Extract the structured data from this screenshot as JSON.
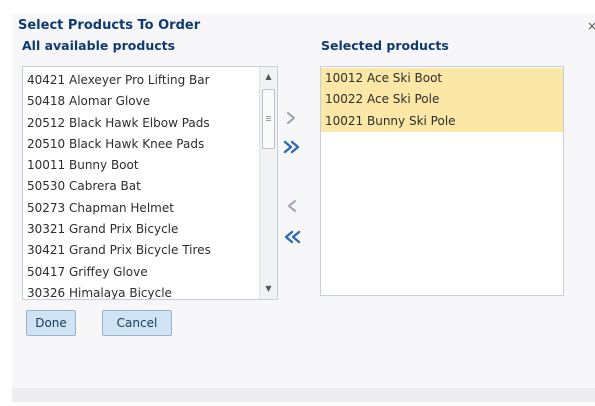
{
  "dialog": {
    "title": "Select Products To Order",
    "close_glyph": "×"
  },
  "available": {
    "heading": "All available products",
    "items": [
      "40421 Alexeyer Pro Lifting Bar",
      "50418 Alomar Glove",
      "20512 Black Hawk Elbow Pads",
      "20510 Black Hawk Knee Pads",
      "10011 Bunny Boot",
      "50530 Cabrera Bat",
      "50273 Chapman Helmet",
      "30321 Grand Prix Bicycle",
      "30421 Grand Prix Bicycle Tires",
      "50417 Griffey Glove",
      "30326 Himalaya Bicycle"
    ]
  },
  "selected": {
    "heading": "Selected products",
    "items": [
      "10012 Ace Ski Boot",
      "10022 Ace Ski Pole",
      "10021 Bunny Ski Pole"
    ]
  },
  "move_buttons": {
    "move": "move-right-icon",
    "move_all": "move-all-right-icon",
    "remove": "move-left-icon",
    "remove_all": "move-all-left-icon"
  },
  "actions": {
    "done": "Done",
    "cancel": "Cancel"
  },
  "colors": {
    "heading": "#0f3a70",
    "selected_item": "#fbe7a6",
    "button": "#cfe3f5",
    "arrow_active": "#2d6bb3",
    "arrow_inactive": "#9aa3ad"
  }
}
